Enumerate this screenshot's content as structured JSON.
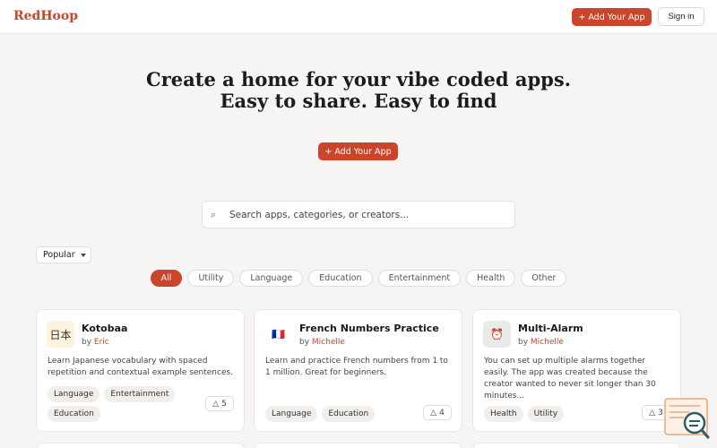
{
  "header": {
    "logo": "RedHoop",
    "add_button": "+ Add Your App",
    "signin_button": "Sign in"
  },
  "hero": {
    "title_line1": "Create a home for your vibe coded apps.",
    "title_line2": "Easy to share. Easy to find",
    "add_button": "+ Add Your App"
  },
  "search": {
    "placeholder": "Search apps, categories, or creators...",
    "icon": "search-icon"
  },
  "sort": {
    "label": "Popular"
  },
  "filters": [
    "All",
    "Utility",
    "Language",
    "Education",
    "Entertainment",
    "Health",
    "Other"
  ],
  "active_filter": "All",
  "cards": [
    {
      "title": "Kotobaa",
      "by": "by",
      "author": "Eric",
      "icon_glyph": "日本",
      "description": "Learn Japanese vocabulary with spaced repetition and contextual example sentences.",
      "tags": [
        "Language",
        "Entertainment",
        "Education"
      ],
      "votes": "5",
      "vote_arrow": "△"
    },
    {
      "title": "French Numbers Practice",
      "by": "by",
      "author": "Michelle",
      "icon_glyph": "🇫🇷",
      "description": "Learn and practice French numbers from 1 to 1 million. Great for beginners.",
      "tags": [
        "Language",
        "Education"
      ],
      "votes": "4",
      "vote_arrow": "△"
    },
    {
      "title": "Multi-Alarm",
      "by": "by",
      "author": "Michelle",
      "icon_glyph": "⏰",
      "description": "You can set up multiple alarms together easily. The app was created because the creator wanted to never sit longer than 30 minutes...",
      "tags": [
        "Health",
        "Utility"
      ],
      "votes": "3",
      "vote_arrow": "△"
    }
  ],
  "colors": {
    "accent": "#c9462c",
    "background": "#f7f5f3"
  }
}
